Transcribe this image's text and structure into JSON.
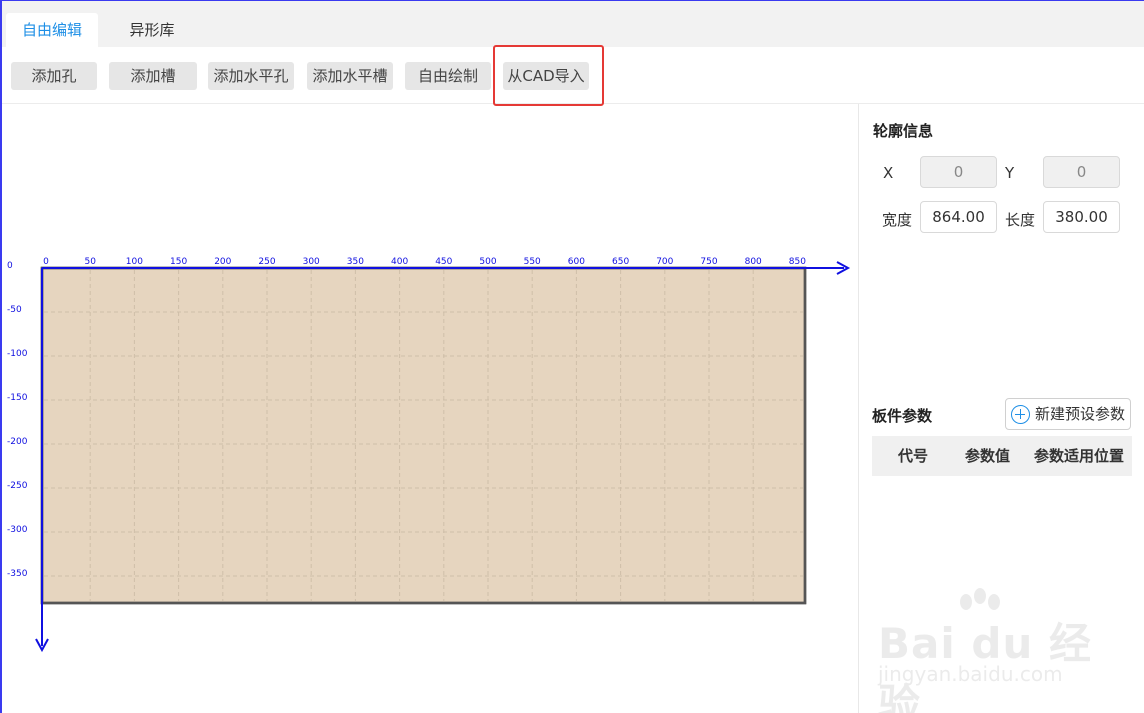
{
  "tabs": [
    {
      "label": "自由编辑",
      "active": true
    },
    {
      "label": "异形库",
      "active": false
    }
  ],
  "toolbar": {
    "buttons": [
      "添加孔",
      "添加槽",
      "添加水平孔",
      "添加水平槽",
      "自由绘制",
      "从CAD导入"
    ],
    "highlighted": "从CAD导入",
    "highlight_color": "#e53935"
  },
  "canvas": {
    "x_ticks": [
      "0",
      "50",
      "100",
      "150",
      "200",
      "250",
      "300",
      "350",
      "400",
      "450",
      "500",
      "550",
      "600",
      "650",
      "700",
      "750",
      "800",
      "850"
    ],
    "y_ticks": [
      "0",
      "-50",
      "-100",
      "-150",
      "-200",
      "-250",
      "-300",
      "-350"
    ],
    "board_fill": "#e6d5bf",
    "axis_color": "#1010e0"
  },
  "profile": {
    "title": "轮廓信息",
    "x_label": "X",
    "x_value": "0",
    "y_label": "Y",
    "y_value": "0",
    "width_label": "宽度",
    "width_value": "864.00",
    "length_label": "长度",
    "length_value": "380.00"
  },
  "params": {
    "title": "板件参数",
    "new_button": "新建预设参数",
    "new_icon": "plus-circle-icon",
    "columns": [
      "代号",
      "参数值",
      "参数适用位置"
    ]
  },
  "watermark": {
    "main": "Bai du 经验",
    "sub": "jingyan.baidu.com"
  }
}
